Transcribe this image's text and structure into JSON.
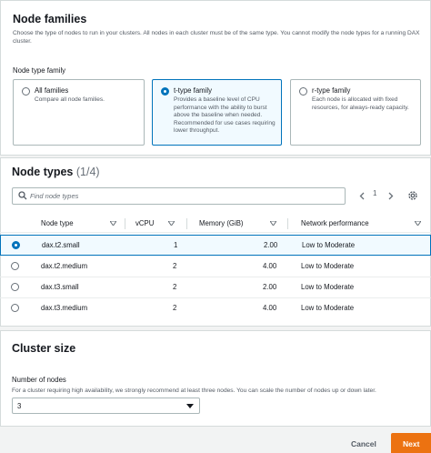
{
  "node_families": {
    "title": "Node families",
    "description": "Choose the type of nodes to run in your clusters. All nodes in each cluster must be of the same type. You cannot modify the node types for a running DAX cluster.",
    "field_label": "Node type family",
    "options": [
      {
        "title": "All families",
        "desc": "Compare all node families.",
        "selected": false
      },
      {
        "title": "t-type family",
        "desc": "Provides a baseline level of CPU performance with the ability to burst above the baseline when needed. Recommended for use cases requiring lower throughput.",
        "selected": true
      },
      {
        "title": "r-type family",
        "desc": "Each node is allocated with fixed resources, for always-ready capacity.",
        "selected": false
      }
    ]
  },
  "node_types": {
    "title": "Node types",
    "count": "(1/4)",
    "search_placeholder": "Find node types",
    "page": "1",
    "columns": [
      "Node type",
      "vCPU",
      "Memory (GiB)",
      "Network performance"
    ],
    "rows": [
      {
        "type": "dax.t2.small",
        "vcpu": "1",
        "memory": "2.00",
        "network": "Low to Moderate",
        "selected": true
      },
      {
        "type": "dax.t2.medium",
        "vcpu": "2",
        "memory": "4.00",
        "network": "Low to Moderate",
        "selected": false
      },
      {
        "type": "dax.t3.small",
        "vcpu": "2",
        "memory": "2.00",
        "network": "Low to Moderate",
        "selected": false
      },
      {
        "type": "dax.t3.medium",
        "vcpu": "2",
        "memory": "4.00",
        "network": "Low to Moderate",
        "selected": false
      }
    ]
  },
  "cluster_size": {
    "title": "Cluster size",
    "field_label": "Number of nodes",
    "description": "For a cluster requiring high availability, we strongly recommend at least three nodes. You can scale the number of nodes up or down later.",
    "value": "3"
  },
  "footer": {
    "cancel_label": "Cancel",
    "next_label": "Next"
  },
  "colors": {
    "accent": "#0073bb",
    "primary_button": "#ec7211"
  },
  "icons": [
    "search-icon",
    "chevron-left-icon",
    "chevron-right-icon",
    "settings-icon",
    "sort-caret-icon",
    "dropdown-caret-icon"
  ]
}
